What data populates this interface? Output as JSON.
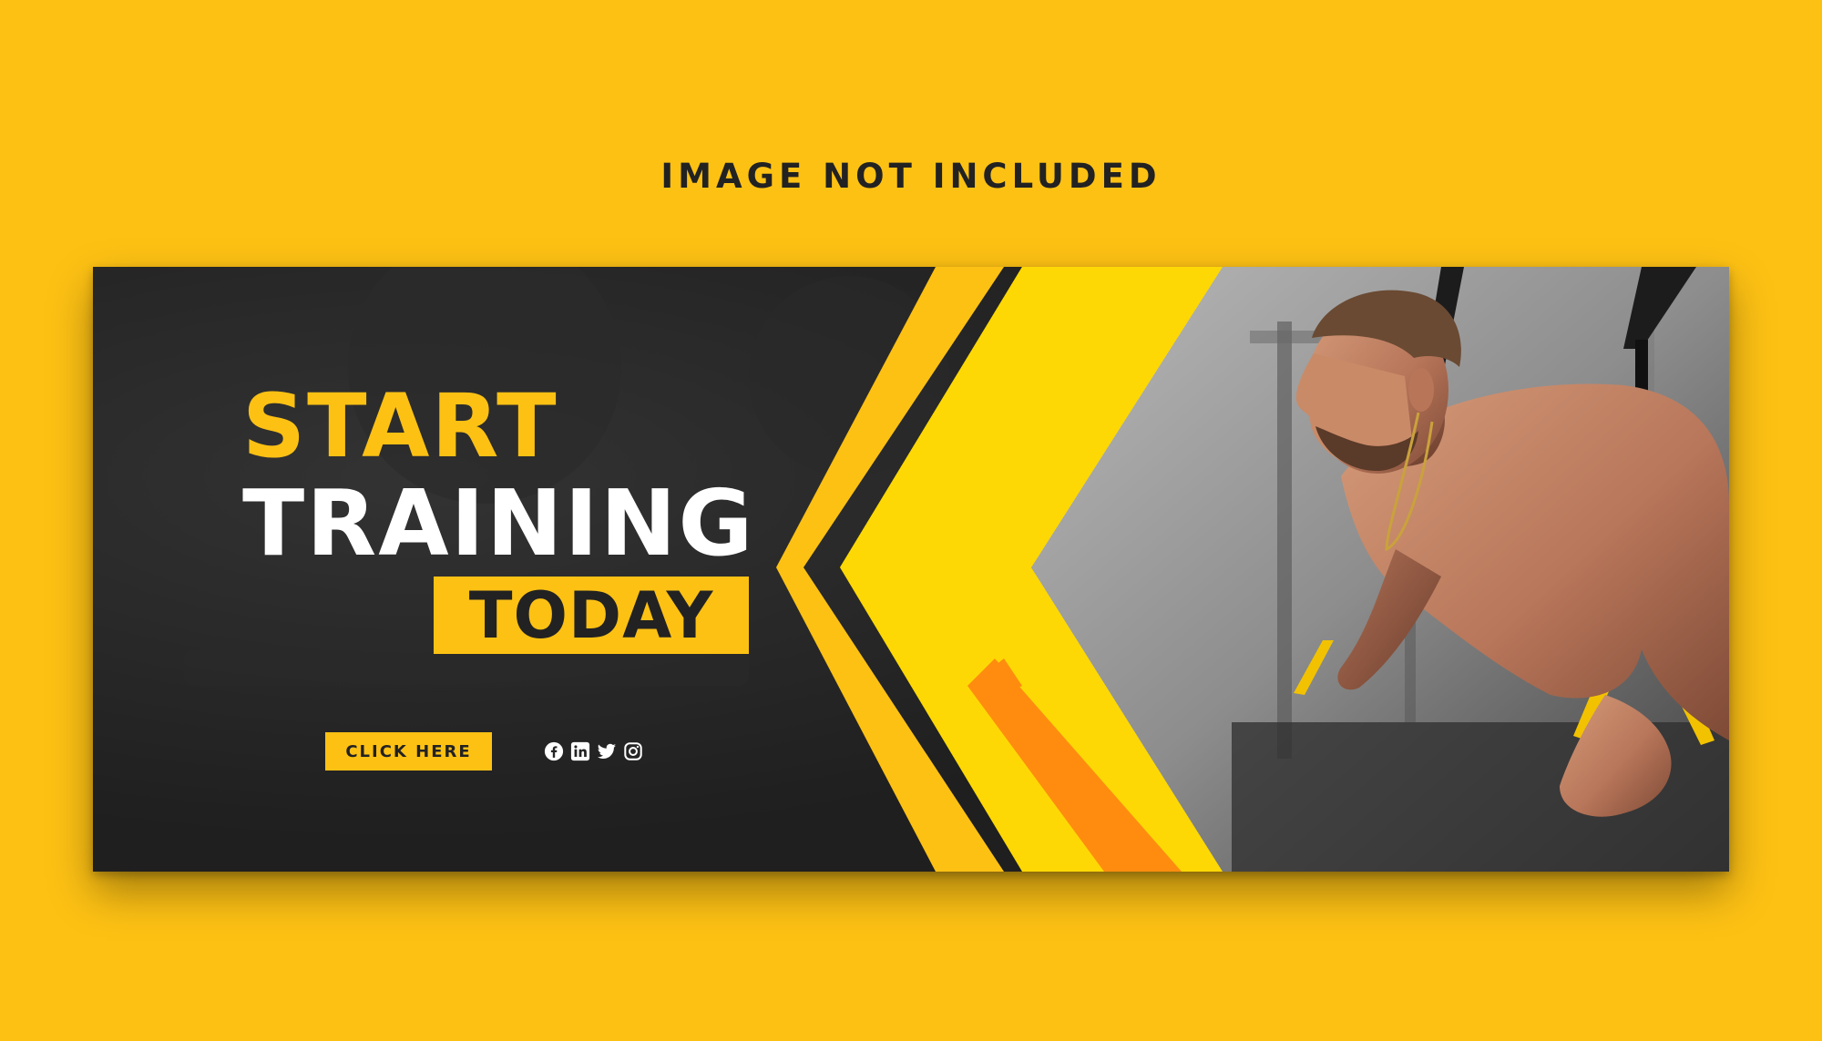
{
  "page": {
    "note": "IMAGE NOT INCLUDED",
    "background_color": "#FDC114"
  },
  "banner": {
    "headline_line1": "START",
    "headline_line2": "TRAINING",
    "highlight": "TODAY",
    "cta_label": "CLICK HERE",
    "social_icons": [
      "facebook-icon",
      "linkedin-icon",
      "twitter-icon",
      "instagram-icon"
    ],
    "colors": {
      "dark": "#242424",
      "accent_yellow": "#FDC114",
      "bright_yellow": "#FDD805",
      "orange": "#FF8C0F",
      "text_light": "#FFFFFF",
      "text_dark": "#222222"
    }
  }
}
